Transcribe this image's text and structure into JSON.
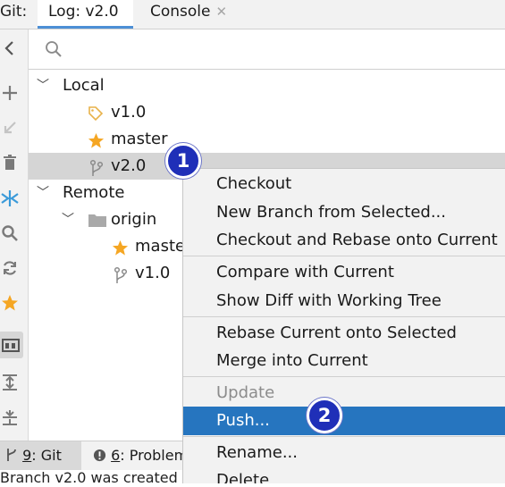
{
  "tabbar": {
    "git_label": "Git:",
    "tabs": [
      {
        "label": "Log: v2.0",
        "active": true
      },
      {
        "label": "Console",
        "closable": true
      }
    ]
  },
  "search": {
    "placeholder": ""
  },
  "tree": {
    "local": {
      "label": "Local",
      "items": [
        {
          "label": "v1.0",
          "icon": "tag-icon"
        },
        {
          "label": "master",
          "icon": "star-icon"
        },
        {
          "label": "v2.0",
          "icon": "branch-icon",
          "selected": true
        }
      ]
    },
    "remote": {
      "label": "Remote",
      "origin": {
        "label": "origin",
        "icon": "folder-icon",
        "items": [
          {
            "label": "maste",
            "icon": "star-icon"
          },
          {
            "label": "v1.0",
            "icon": "branch-icon"
          }
        ]
      }
    }
  },
  "context_menu": {
    "items": [
      {
        "label": "Checkout"
      },
      {
        "label": "New Branch from Selected..."
      },
      {
        "label": "Checkout and Rebase onto Current"
      },
      {
        "label": "Compare with Current"
      },
      {
        "label": "Show Diff with Working Tree"
      },
      {
        "label": "Rebase Current onto Selected"
      },
      {
        "label": "Merge into Current"
      },
      {
        "label": "Update",
        "disabled": true
      },
      {
        "label": "Push...",
        "highlighted": true
      },
      {
        "label": "Rename..."
      },
      {
        "label": "Delete"
      }
    ]
  },
  "callouts": [
    "1",
    "2"
  ],
  "bottombar": {
    "git_tab": {
      "num": "9",
      "label": ": Git"
    },
    "problems_tab": {
      "num": "6",
      "label": ": Problem"
    }
  },
  "status": {
    "text": "Branch v2.0 was created"
  },
  "colors": {
    "accent": "#2675bf",
    "tab_underline": "#4d8fd6",
    "star": "#f5a623",
    "tag": "#e8b24a",
    "callout": "#1f2fb8",
    "toolbar_icon": "#7a7a7a",
    "merge_icon": "#3a9ad9"
  }
}
